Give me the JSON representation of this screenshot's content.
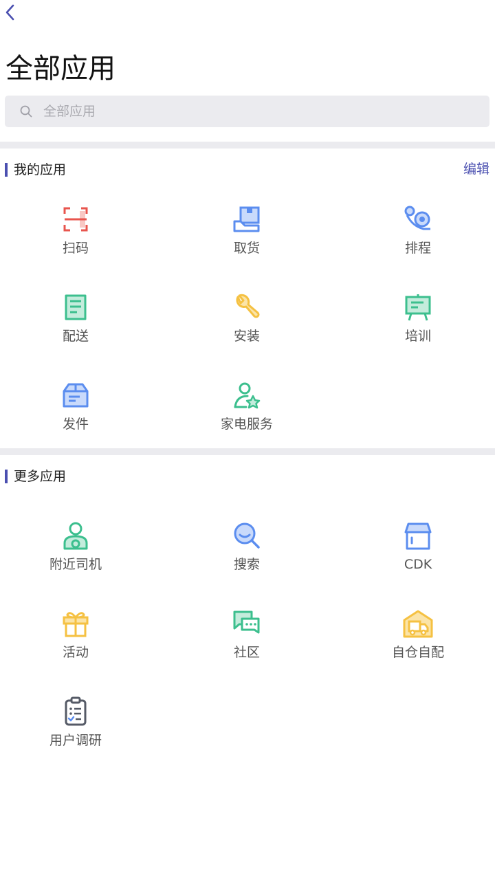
{
  "header": {
    "title": "全部应用"
  },
  "search": {
    "placeholder": "全部应用",
    "value": ""
  },
  "my_apps": {
    "title": "我的应用",
    "edit_label": "编辑",
    "items": [
      {
        "label": "扫码",
        "icon": "scan-icon"
      },
      {
        "label": "取货",
        "icon": "pickup-box-icon"
      },
      {
        "label": "排程",
        "icon": "schedule-route-icon"
      },
      {
        "label": "配送",
        "icon": "delivery-list-icon"
      },
      {
        "label": "安装",
        "icon": "wrench-icon"
      },
      {
        "label": "培训",
        "icon": "training-board-icon"
      },
      {
        "label": "发件",
        "icon": "package-send-icon"
      },
      {
        "label": "家电服务",
        "icon": "service-person-star-icon"
      }
    ]
  },
  "more_apps": {
    "title": "更多应用",
    "items": [
      {
        "label": "附近司机",
        "icon": "driver-icon"
      },
      {
        "label": "搜索",
        "icon": "search-magnifier-icon"
      },
      {
        "label": "CDK",
        "icon": "store-icon"
      },
      {
        "label": "活动",
        "icon": "gift-icon"
      },
      {
        "label": "社区",
        "icon": "chat-bubbles-icon"
      },
      {
        "label": "自仓自配",
        "icon": "warehouse-truck-icon"
      },
      {
        "label": "用户调研",
        "icon": "clipboard-survey-icon"
      }
    ]
  },
  "colors": {
    "accent": "#4a4fb0",
    "red": "#e8554e",
    "blue": "#5b8def",
    "green": "#3cbf8e",
    "yellow": "#f5c142",
    "dark": "#555a66"
  }
}
